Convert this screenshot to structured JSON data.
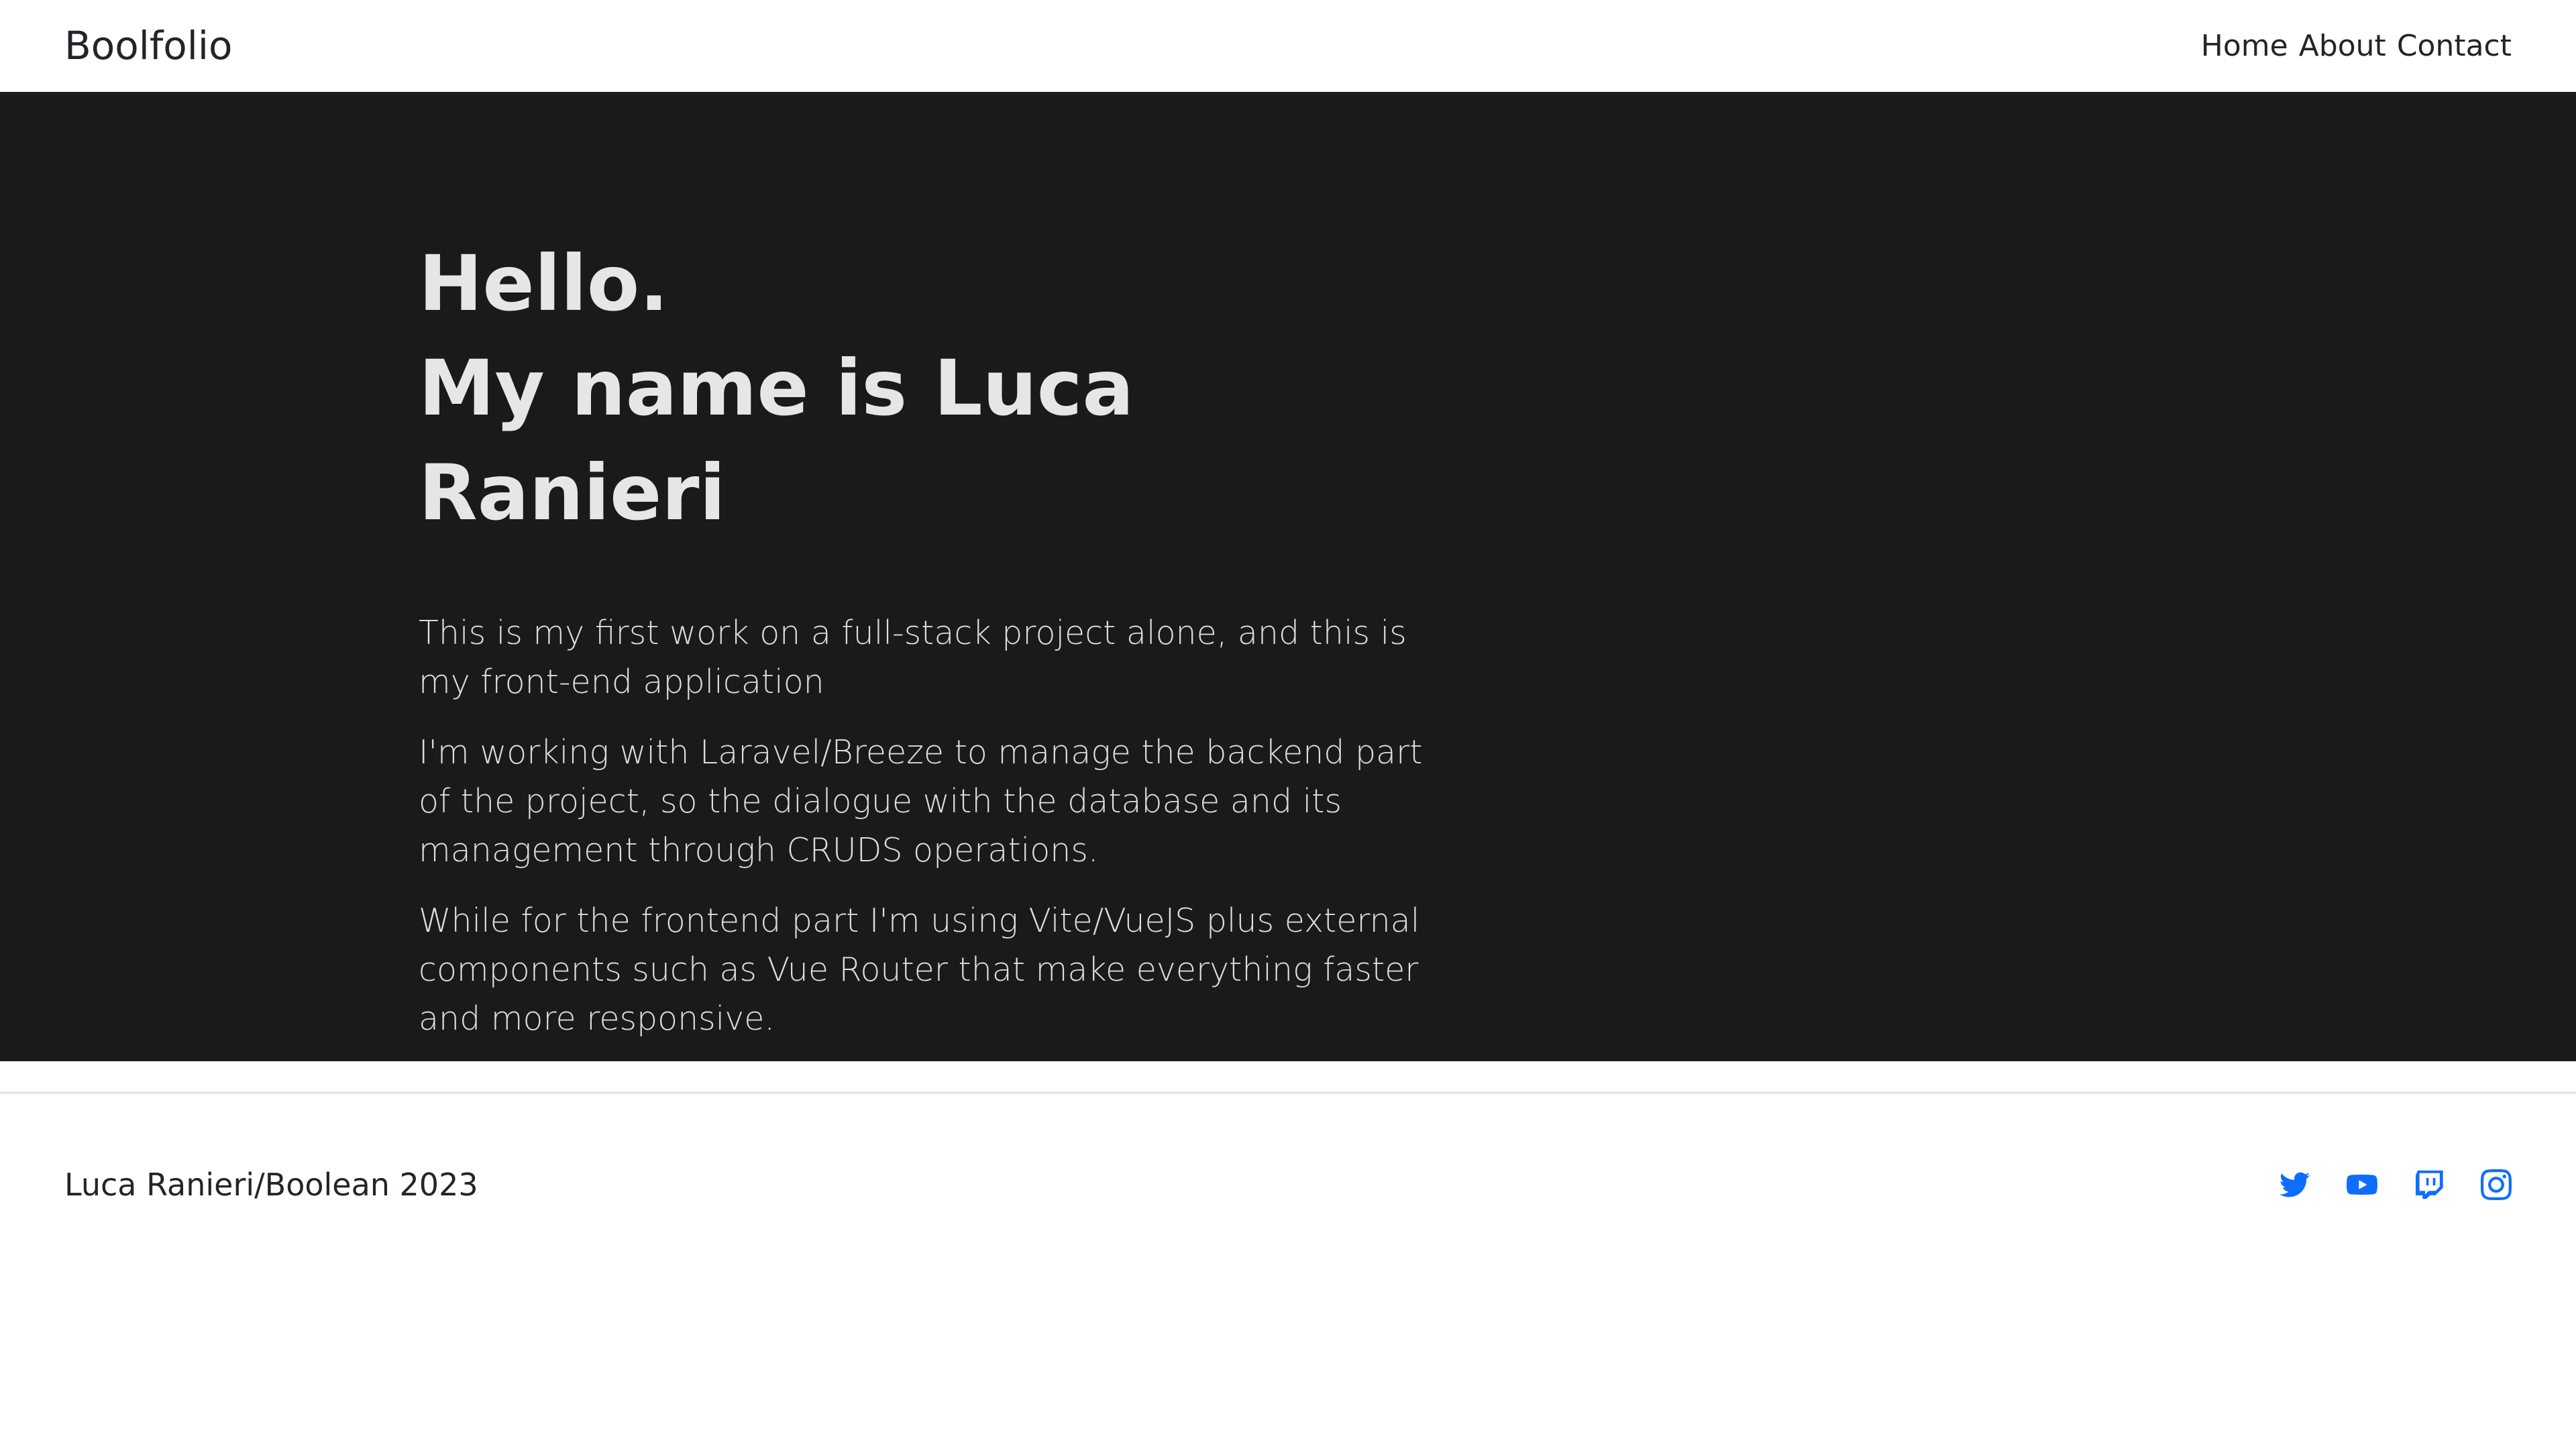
{
  "navbar": {
    "brand": "Boolfolio",
    "links": [
      {
        "label": "Home"
      },
      {
        "label": "About"
      },
      {
        "label": "Contact"
      }
    ]
  },
  "hero": {
    "title_line1": "Hello.",
    "title_line2": "My name is Luca Ranieri",
    "paragraphs": [
      "This is my first work on a full-stack project alone, and this is my front-end application",
      "I'm working with Laravel/Breeze to manage the backend part of the project, so the dialogue with the database and its management through CRUDS operations.",
      "While for the frontend part I'm using Vite/VueJS plus external components such as Vue Router that make everything faster and more responsive."
    ]
  },
  "footer": {
    "credit": "Luca Ranieri/Boolean 2023",
    "socials": [
      {
        "icon": "twitter-icon"
      },
      {
        "icon": "youtube-icon"
      },
      {
        "icon": "twitch-icon"
      },
      {
        "icon": "instagram-icon"
      }
    ]
  },
  "colors": {
    "hero_background": "#1a1a1a",
    "hero_text": "#e6e6e6",
    "social_icon": "#0d6efd",
    "text_dark": "#212529"
  }
}
